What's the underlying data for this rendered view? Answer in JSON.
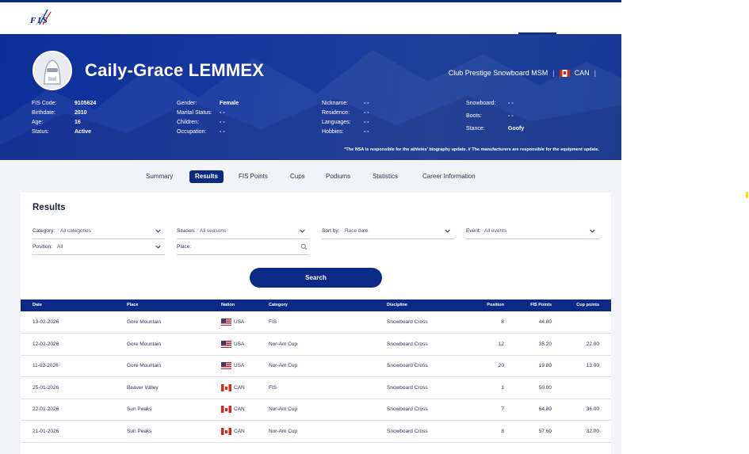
{
  "brand": {
    "logo_text": "FIS"
  },
  "athlete": {
    "name": "Caily-Grace LEMMEX",
    "club": "Club Prestige Snowboard MSM",
    "nation": "CAN",
    "col1": [
      {
        "label": "FIS Code:",
        "value": "9105624"
      },
      {
        "label": "Birthdate:",
        "value": "2010"
      },
      {
        "label": "Age:",
        "value": "16"
      },
      {
        "label": "Status:",
        "value": "Active"
      }
    ],
    "col2": [
      {
        "label": "Gender:",
        "value": "Female"
      },
      {
        "label": "Marital Status:",
        "value": "- -"
      },
      {
        "label": "Children:",
        "value": "- -"
      },
      {
        "label": "Occupation:",
        "value": "- -"
      }
    ],
    "col3": [
      {
        "label": "Nickname:",
        "value": "- -"
      },
      {
        "label": "Residence:",
        "value": "- -"
      },
      {
        "label": "Languages:",
        "value": "- -"
      },
      {
        "label": "Hobbies:",
        "value": "- -"
      }
    ],
    "col4": [
      {
        "label": "Snowboard:",
        "value": "- -"
      },
      {
        "label": "Boots:",
        "value": "- -"
      },
      {
        "label": "Stance:",
        "value": "Goofy"
      }
    ],
    "note": "*The NSA is responsible for the athletes' biography update. // The manufacturers are responsible for the equipment update."
  },
  "tabs": [
    "Summary",
    "Results",
    "FIS Points",
    "Cups",
    "Podiums",
    "Statistics",
    "Career Information"
  ],
  "active_tab": "Results",
  "results": {
    "title": "Results",
    "filters": {
      "category": {
        "label": "Category:",
        "value": "All categories"
      },
      "season": {
        "label": "Season:",
        "value": "All seasons"
      },
      "sort_by": {
        "label": "Sort by:",
        "value": "Race date"
      },
      "event": {
        "label": "Event:",
        "value": "All events"
      },
      "position": {
        "label": "Position:",
        "value": "All"
      },
      "place": {
        "label": "Place:",
        "value": ""
      }
    },
    "search_label": "Search",
    "columns": [
      "Date",
      "Place",
      "Nation",
      "Category",
      "Discipline",
      "Position",
      "FIS Points",
      "Cup points"
    ],
    "rows": [
      {
        "date": "13-02-2026",
        "place": "Gore Mountain",
        "nation": "USA",
        "category": "FIS",
        "discipline": "Snowboard Cross",
        "position": "8",
        "fis_points": "44.80",
        "cup_points": ""
      },
      {
        "date": "12-02-2026",
        "place": "Gore Mountain",
        "nation": "USA",
        "category": "Nor-Am Cup",
        "discipline": "Snowboard Cross",
        "position": "12",
        "fis_points": "35.20",
        "cup_points": "22.00"
      },
      {
        "date": "11-02-2026",
        "place": "Gore Mountain",
        "nation": "USA",
        "category": "Nor-Am Cup",
        "discipline": "Snowboard Cross",
        "position": "20",
        "fis_points": "19.80",
        "cup_points": "13.00"
      },
      {
        "date": "25-01-2026",
        "place": "Beaver Valley",
        "nation": "CAN",
        "category": "FIS",
        "discipline": "Snowboard Cross",
        "position": "1",
        "fis_points": "50.00",
        "cup_points": ""
      },
      {
        "date": "22-01-2026",
        "place": "Sun Peaks",
        "nation": "CAN",
        "category": "Nor-Am Cup",
        "discipline": "Snowboard Cross",
        "position": "7",
        "fis_points": "64.80",
        "cup_points": "36.00"
      },
      {
        "date": "21-01-2026",
        "place": "Sun Peaks",
        "nation": "CAN",
        "category": "Nor-Am Cup",
        "discipline": "Snowboard Cross",
        "position": "8",
        "fis_points": "57.60",
        "cup_points": "32.00"
      }
    ]
  },
  "colors": {
    "primary": "#0b2a86",
    "accent_yellow": "#f5e400",
    "page_bg": "#f2f3f7"
  }
}
